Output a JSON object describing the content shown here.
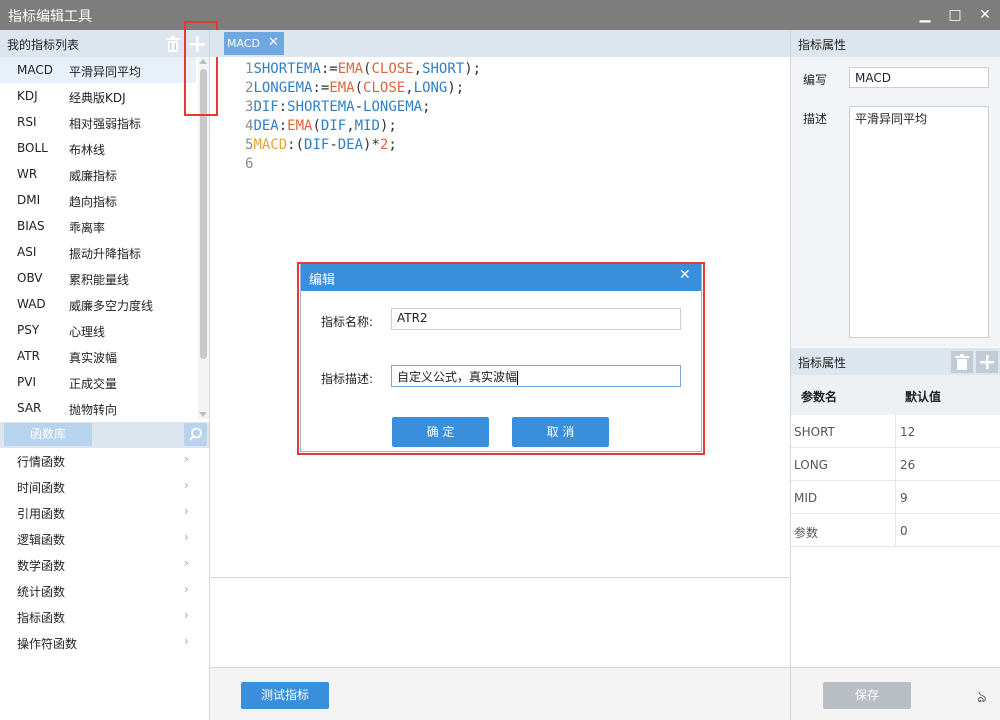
{
  "window": {
    "title": "指标编辑工具",
    "minimize": "▁",
    "maximize": "□",
    "close": "✕"
  },
  "left_panel": {
    "header": "我的指标列表",
    "indicators": [
      {
        "code": "MACD",
        "desc": "平滑异同平均"
      },
      {
        "code": "KDJ",
        "desc": "经典版KDJ"
      },
      {
        "code": "RSI",
        "desc": "相对强弱指标"
      },
      {
        "code": "BOLL",
        "desc": "布林线"
      },
      {
        "code": "WR",
        "desc": "威廉指标"
      },
      {
        "code": "DMI",
        "desc": "趋向指标"
      },
      {
        "code": "BIAS",
        "desc": "乖离率"
      },
      {
        "code": "ASI",
        "desc": "振动升降指标"
      },
      {
        "code": "OBV",
        "desc": "累积能量线"
      },
      {
        "code": "WAD",
        "desc": "威廉多空力度线"
      },
      {
        "code": "PSY",
        "desc": "心理线"
      },
      {
        "code": "ATR",
        "desc": "真实波幅"
      },
      {
        "code": "PVI",
        "desc": "正成交量"
      },
      {
        "code": "SAR",
        "desc": "抛物转向"
      }
    ],
    "function_tab": "函数库",
    "functions": [
      "行情函数",
      "时间函数",
      "引用函数",
      "逻辑函数",
      "数学函数",
      "统计函数",
      "指标函数",
      "操作符函数"
    ]
  },
  "editor": {
    "tab_label": "MACD",
    "tab_close": "✕",
    "line_numbers": [
      "1",
      "2",
      "3",
      "4",
      "5",
      "6"
    ],
    "code": {
      "l1": [
        "SHORTEMA",
        ":=",
        "EMA",
        "(",
        "CLOSE",
        ",",
        "SHORT",
        ");"
      ],
      "l2": [
        "LONGEMA",
        ":=",
        "EMA",
        "(",
        "CLOSE",
        ",",
        "LONG",
        ");"
      ],
      "l3": [
        "DIF",
        ":",
        "SHORTEMA",
        "-",
        "LONGEMA",
        ";"
      ],
      "l4": [
        "DEA",
        ":",
        "EMA",
        "(",
        "DIF",
        ",",
        "MID",
        ");"
      ],
      "l5": [
        "MACD",
        ":(",
        "DIF",
        "-",
        "DEA",
        ")*",
        "2",
        ";"
      ]
    },
    "test_button": "测试指标"
  },
  "right_panel": {
    "header": "指标属性",
    "abbr_label": "编写",
    "abbr_value": "MACD",
    "desc_label": "描述",
    "desc_value": "平滑异同平均",
    "param_header": "指标属性",
    "param_cols": [
      "参数名",
      "默认值"
    ],
    "params": [
      {
        "name": "SHORT",
        "value": "12"
      },
      {
        "name": "LONG",
        "value": "26"
      },
      {
        "name": "MID",
        "value": "9"
      },
      {
        "name": "参数",
        "value": "0"
      }
    ],
    "save_button": "保存"
  },
  "dialog": {
    "title": "编辑",
    "close": "✕",
    "name_label": "指标名称:",
    "name_value": "ATR2",
    "desc_label": "指标描述:",
    "desc_value": "自定义公式，真实波幅",
    "ok": "确 定",
    "cancel": "取 消"
  },
  "colors": {
    "accent": "#3a8fdc",
    "highlight": "#e53935",
    "header_bg": "#dde5ee",
    "code_identifier": "#2f7fc8",
    "code_function": "#e0653a",
    "code_output": "#e8a23a"
  }
}
